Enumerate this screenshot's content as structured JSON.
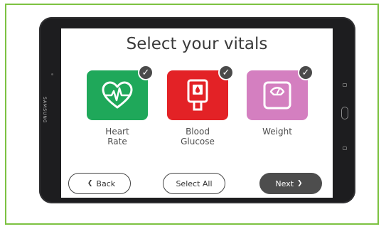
{
  "screen": {
    "title": "Select your vitals"
  },
  "device": {
    "brand": "SAMSUNG"
  },
  "vitals": [
    {
      "label_line1": "Heart",
      "label_line2": "Rate",
      "color": "#1fa85a",
      "icon": "heart-rate-icon",
      "selected": true
    },
    {
      "label_line1": "Blood",
      "label_line2": "Glucose",
      "color": "#e32226",
      "icon": "glucose-meter-icon",
      "selected": true
    },
    {
      "label_line1": "Weight",
      "label_line2": "",
      "color": "#d47fc0",
      "icon": "scale-icon",
      "selected": true
    }
  ],
  "buttons": {
    "back": "Back",
    "select_all": "Select All",
    "next": "Next"
  },
  "colors": {
    "frame_border": "#7dc242",
    "next_button": "#4d4d4d"
  }
}
